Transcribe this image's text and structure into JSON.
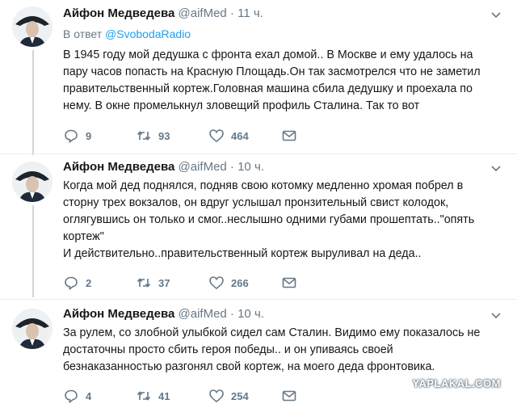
{
  "tweets": [
    {
      "name": "Айфон Медведева",
      "handle": "@aifMed",
      "dot": "·",
      "time": "11 ч.",
      "reply_prefix": "В ответ",
      "reply_handle": "@SvobodaRadio",
      "text": "В 1945 году мой дедушка  с фронта ехал домой.. В Москве и ему удалось  на\nпару часов попасть на Красную Площадь.Он так засмотрелся  что не заметил\nправительственный кортеж.Головная машина сбила дедушку и проехала по\nнему. В окне промелькнул зловещий профиль Сталина. Так то вот",
      "replies": "9",
      "retweets": "93",
      "likes": "464"
    },
    {
      "name": "Айфон Медведева",
      "handle": "@aifMed",
      "dot": "·",
      "time": "10 ч.",
      "text": "Когда мой дед поднялся, подняв свою котомку медленно хромая побрел в\nсторну трех вокзалов, он вдруг услышал пронзительный свист колодок,\nоглягувшись он только и смог..неслышно одними губами прошептать..\"опять\nкортеж\"\n  И действительно..правительственный кортеж выруливал на деда..",
      "replies": "2",
      "retweets": "37",
      "likes": "266"
    },
    {
      "name": "Айфон Медведева",
      "handle": "@aifMed",
      "dot": "·",
      "time": "10 ч.",
      "text": "За рулем, со злобной улыбкой сидел сам Сталин. Видимо ему показалось не\nдостаточны просто сбить героя победы.. и он упиваясь своей\nбезнаказанностью разгонял свой кортеж, на моего деда фронтовика.",
      "replies": "4",
      "retweets": "41",
      "likes": "254"
    }
  ],
  "icons": {
    "reply": "reply-icon",
    "retweet": "retweet-icon",
    "like": "heart-icon",
    "message": "mail-icon",
    "menu": "chevron-down-icon"
  },
  "colors": {
    "accent": "#1da1f2",
    "secondary_text": "#657786",
    "thread_line": "#ccd6dd"
  },
  "watermark": "YAPLAKAL.COM"
}
